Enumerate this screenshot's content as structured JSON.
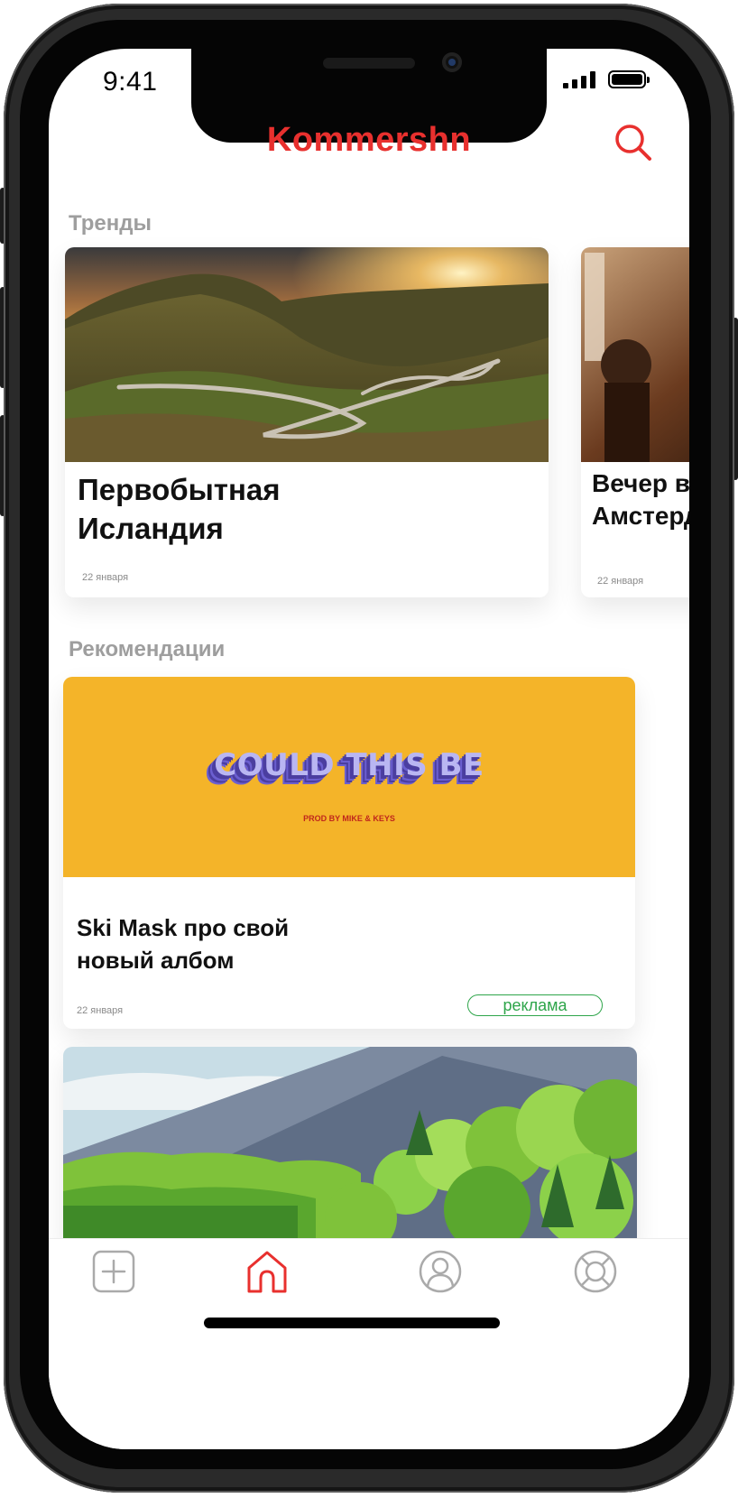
{
  "status_bar": {
    "time": "9:41"
  },
  "header": {
    "app_title": "Kommershn"
  },
  "trends": {
    "section_title": "Тренды",
    "cards": [
      {
        "title_line1": "Первобытная",
        "title_line2": "Исландия",
        "date": "22 января"
      },
      {
        "title_line1": "Вечер в",
        "title_line2": "Амстердаме",
        "date": "22 января"
      }
    ]
  },
  "recommendations": {
    "section_title": "Рекомендации",
    "cards": [
      {
        "cover_title": "COULD THIS BE",
        "cover_subtitle": "PROD BY MIKE & KEYS",
        "title_line1": "Ski Mask про свой",
        "title_line2": "новый албом",
        "date": "22 января",
        "badge": "реклама"
      }
    ]
  },
  "tabbar": {
    "icons": [
      "plus-square-icon",
      "home-icon",
      "user-icon",
      "lifebuoy-icon"
    ],
    "active_color": "#e8302e",
    "inactive_color": "#aaaaaa"
  },
  "colors": {
    "brand": "#e8302e",
    "ad_badge": "#2ea54a",
    "section_title": "#9e9e9e"
  }
}
